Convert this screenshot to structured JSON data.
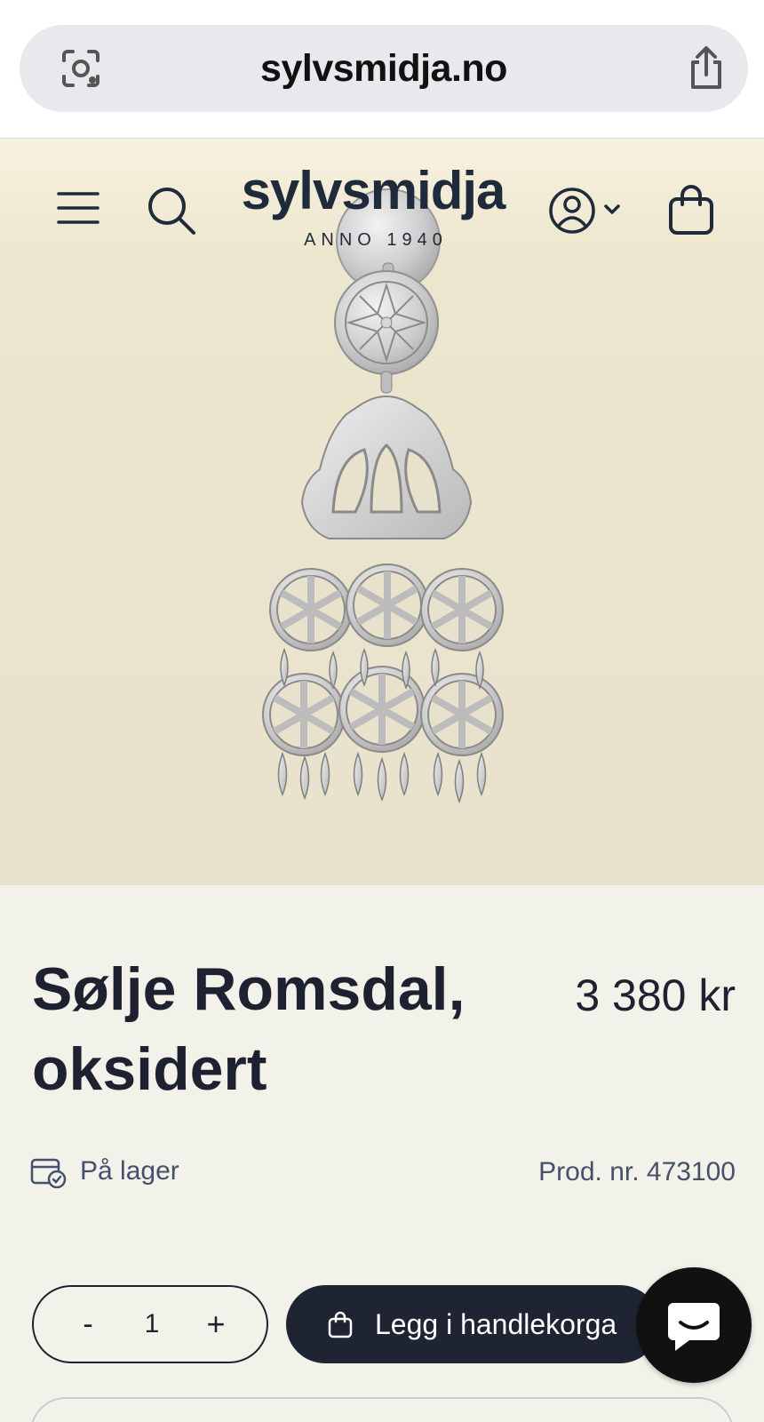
{
  "browser": {
    "url": "sylvsmidja.no",
    "lens_icon": "lens-icon",
    "share_icon": "share-icon"
  },
  "header": {
    "logo_text": "sylvsmidja",
    "logo_subtitle": "ANNO 1940",
    "menu_icon": "menu-icon",
    "search_icon": "search-icon",
    "account_icon": "account-icon",
    "cart_icon": "shopping-bag-icon"
  },
  "product": {
    "title": "Sølje Romsdal, oksidert",
    "price": "3 380 kr",
    "stock_status": "På lager",
    "product_number": "Prod. nr. 473100"
  },
  "purchase": {
    "qty_minus": "-",
    "qty_value": "1",
    "qty_plus": "+",
    "add_to_cart_label": "Legg i handlekorga"
  },
  "colors": {
    "brand_dark": "#1f2433",
    "hero_bg": "#e8e1cc",
    "page_bg": "#f2f1ea",
    "muted_text": "#45506a"
  }
}
